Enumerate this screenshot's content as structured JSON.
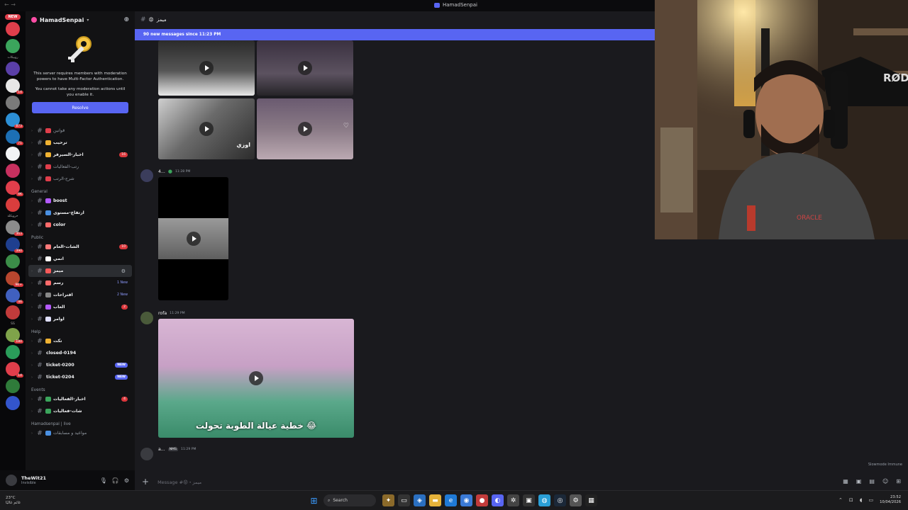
{
  "window": {
    "title": "HamadSenpai"
  },
  "rail": {
    "new_badge": "NEW",
    "label_1": "روبيكات",
    "label_2": "حروبكلة",
    "label_3": "SS",
    "badges": [
      "14",
      "873",
      "71",
      "4K",
      "363",
      "390",
      "9K+",
      "46",
      "180",
      "14"
    ]
  },
  "server": {
    "name": "HamadSenpai",
    "mfa_message": "This server requires members with moderation powers to have Multi-Factor Authentication.",
    "mfa_notice": "You cannot take any moderation actions until you enable it.",
    "resolve_label": "Resolve"
  },
  "channels": [
    {
      "type": "row",
      "name": "قوانين",
      "emoji_color": "#e03e4b",
      "unread": false
    },
    {
      "type": "row",
      "name": "ترحيب",
      "emoji_color": "#f0b232",
      "unread": true
    },
    {
      "type": "row",
      "name": "اخبار-السيرفر",
      "emoji_color": "#f0b232",
      "unread": true,
      "count": "16"
    },
    {
      "type": "row",
      "name": "رتب-الفعاليات",
      "emoji_color": "#e03e4b",
      "unread": false
    },
    {
      "type": "row",
      "name": "شرح-الرتب",
      "emoji_color": "#e03e4b",
      "unread": false
    },
    {
      "type": "cat",
      "name": "General"
    },
    {
      "type": "row",
      "name": "boost",
      "emoji_color": "#b45aff",
      "unread": true
    },
    {
      "type": "row",
      "name": "ارتفاع-مستوى",
      "emoji_color": "#4a90e2",
      "unread": true
    },
    {
      "type": "row",
      "name": "color",
      "emoji_color": "#ff6b6b",
      "unread": true
    },
    {
      "type": "cat",
      "name": "Public"
    },
    {
      "type": "row",
      "name": "الشات-العام",
      "emoji_color": "#ff7a7a",
      "unread": true,
      "count": "10"
    },
    {
      "type": "row",
      "name": "انمي",
      "emoji_color": "#ffffff",
      "unread": true
    },
    {
      "type": "row",
      "name": "ميمز",
      "emoji_color": "#f75a5a",
      "unread": true,
      "active": true
    },
    {
      "type": "row",
      "name": "رسم",
      "emoji_color": "#ff6b6b",
      "unread": true,
      "new": "1 New"
    },
    {
      "type": "row",
      "name": "اقتراحات",
      "emoji_color": "#888888",
      "unread": true,
      "new": "2 New"
    },
    {
      "type": "row",
      "name": "العاب",
      "emoji_color": "#b45aff",
      "unread": true,
      "count": "2"
    },
    {
      "type": "row",
      "name": "اوامر",
      "emoji_color": "#e0e0ff",
      "unread": true
    },
    {
      "type": "cat",
      "name": "Help"
    },
    {
      "type": "row",
      "name": "تكت",
      "emoji_color": "#f0b232",
      "unread": true
    },
    {
      "type": "row",
      "name": "closed-0194",
      "emoji_color": "",
      "unread": true
    },
    {
      "type": "row",
      "name": "ticket-0200",
      "emoji_color": "",
      "unread": true,
      "newb": "NEW"
    },
    {
      "type": "row",
      "name": "ticket-0204",
      "emoji_color": "",
      "unread": true,
      "newb": "NEW"
    },
    {
      "type": "cat",
      "name": "Events"
    },
    {
      "type": "row",
      "name": "اخبار-الفعاليات",
      "emoji_color": "#3ba55c",
      "unread": true,
      "count": "4"
    },
    {
      "type": "row",
      "name": "شات-فعاليات",
      "emoji_color": "#3ba55c",
      "unread": true
    },
    {
      "type": "cat",
      "name": "Hamadsenpai | live"
    },
    {
      "type": "row",
      "name": "مواعيد و مسابقات",
      "emoji_color": "#4a90e2",
      "unread": false
    }
  ],
  "user": {
    "name": "TheWit21",
    "status": "Invisible"
  },
  "chat": {
    "channel_name": "ميمز",
    "new_messages_bar": "90 new messages since 11:23 PM",
    "messages": [
      {
        "author": "4...",
        "time": "11:28 PM"
      },
      {
        "author": "rofa",
        "time": "11:29 PM"
      },
      {
        "author": "a...",
        "tag": "NMS",
        "time": "11:29 PM"
      }
    ],
    "video_caption": "خطية عيالة الطوبة تحولت 😂",
    "thumb_overlay": "اوزي",
    "input_placeholder": "Message #😡・ميمز",
    "slowmode": "Slowmode Immune"
  },
  "taskbar": {
    "weather_temp": "23°C",
    "weather_desc": "غائم غالبًا",
    "search_label": "Search",
    "time": "23:52",
    "date": "10/04/2026"
  }
}
